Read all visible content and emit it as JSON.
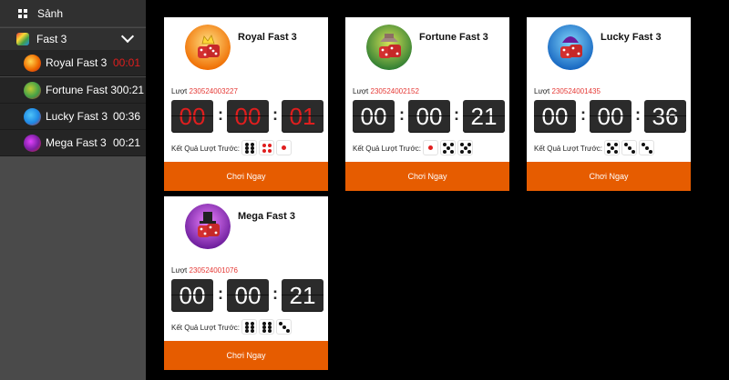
{
  "sidebar": {
    "lobby_label": "Sảnh",
    "group_label": "Fast 3",
    "games": [
      {
        "name": "Royal Fast 3",
        "time": "00:01",
        "urgent": true
      },
      {
        "name": "Fortune Fast 3",
        "time": "00:21",
        "urgent": false
      },
      {
        "name": "Lucky Fast 3",
        "time": "00:36",
        "urgent": false
      },
      {
        "name": "Mega Fast 3",
        "time": "00:21",
        "urgent": false
      }
    ]
  },
  "cards": [
    {
      "title": "Royal Fast 3",
      "round_label": "Lượt",
      "round_id": "230524003227",
      "timer": [
        "00",
        "00",
        "01"
      ],
      "timer_urgent": true,
      "result_label": "Kết Quả Lượt Trước:",
      "dice": [
        6,
        4,
        1
      ],
      "play_label": "Chơi Ngay"
    },
    {
      "title": "Fortune Fast 3",
      "round_label": "Lượt",
      "round_id": "230524002152",
      "timer": [
        "00",
        "00",
        "21"
      ],
      "timer_urgent": false,
      "result_label": "Kết Quả Lượt Trước:",
      "dice": [
        1,
        5,
        5
      ],
      "play_label": "Chơi Ngay"
    },
    {
      "title": "Lucky Fast 3",
      "round_label": "Lượt",
      "round_id": "230524001435",
      "timer": [
        "00",
        "00",
        "36"
      ],
      "timer_urgent": false,
      "result_label": "Kết Quả Lượt Trước:",
      "dice": [
        5,
        3,
        3
      ],
      "play_label": "Chơi Ngay"
    },
    {
      "title": "Mega Fast 3",
      "round_label": "Lượt",
      "round_id": "230524001076",
      "timer": [
        "00",
        "00",
        "21"
      ],
      "timer_urgent": false,
      "result_label": "Kết Quả Lượt Trước:",
      "dice": [
        6,
        6,
        3
      ],
      "play_label": "Chơi Ngay"
    }
  ],
  "colors": {
    "accent": "#e65c00",
    "urgent": "#e01e1e",
    "sidebar": "#4a4a4a",
    "active_row": "#252525"
  },
  "icons": {
    "lobby": "grid-icon",
    "group": "fast3-icon",
    "expand": "chevron-down-icon"
  }
}
